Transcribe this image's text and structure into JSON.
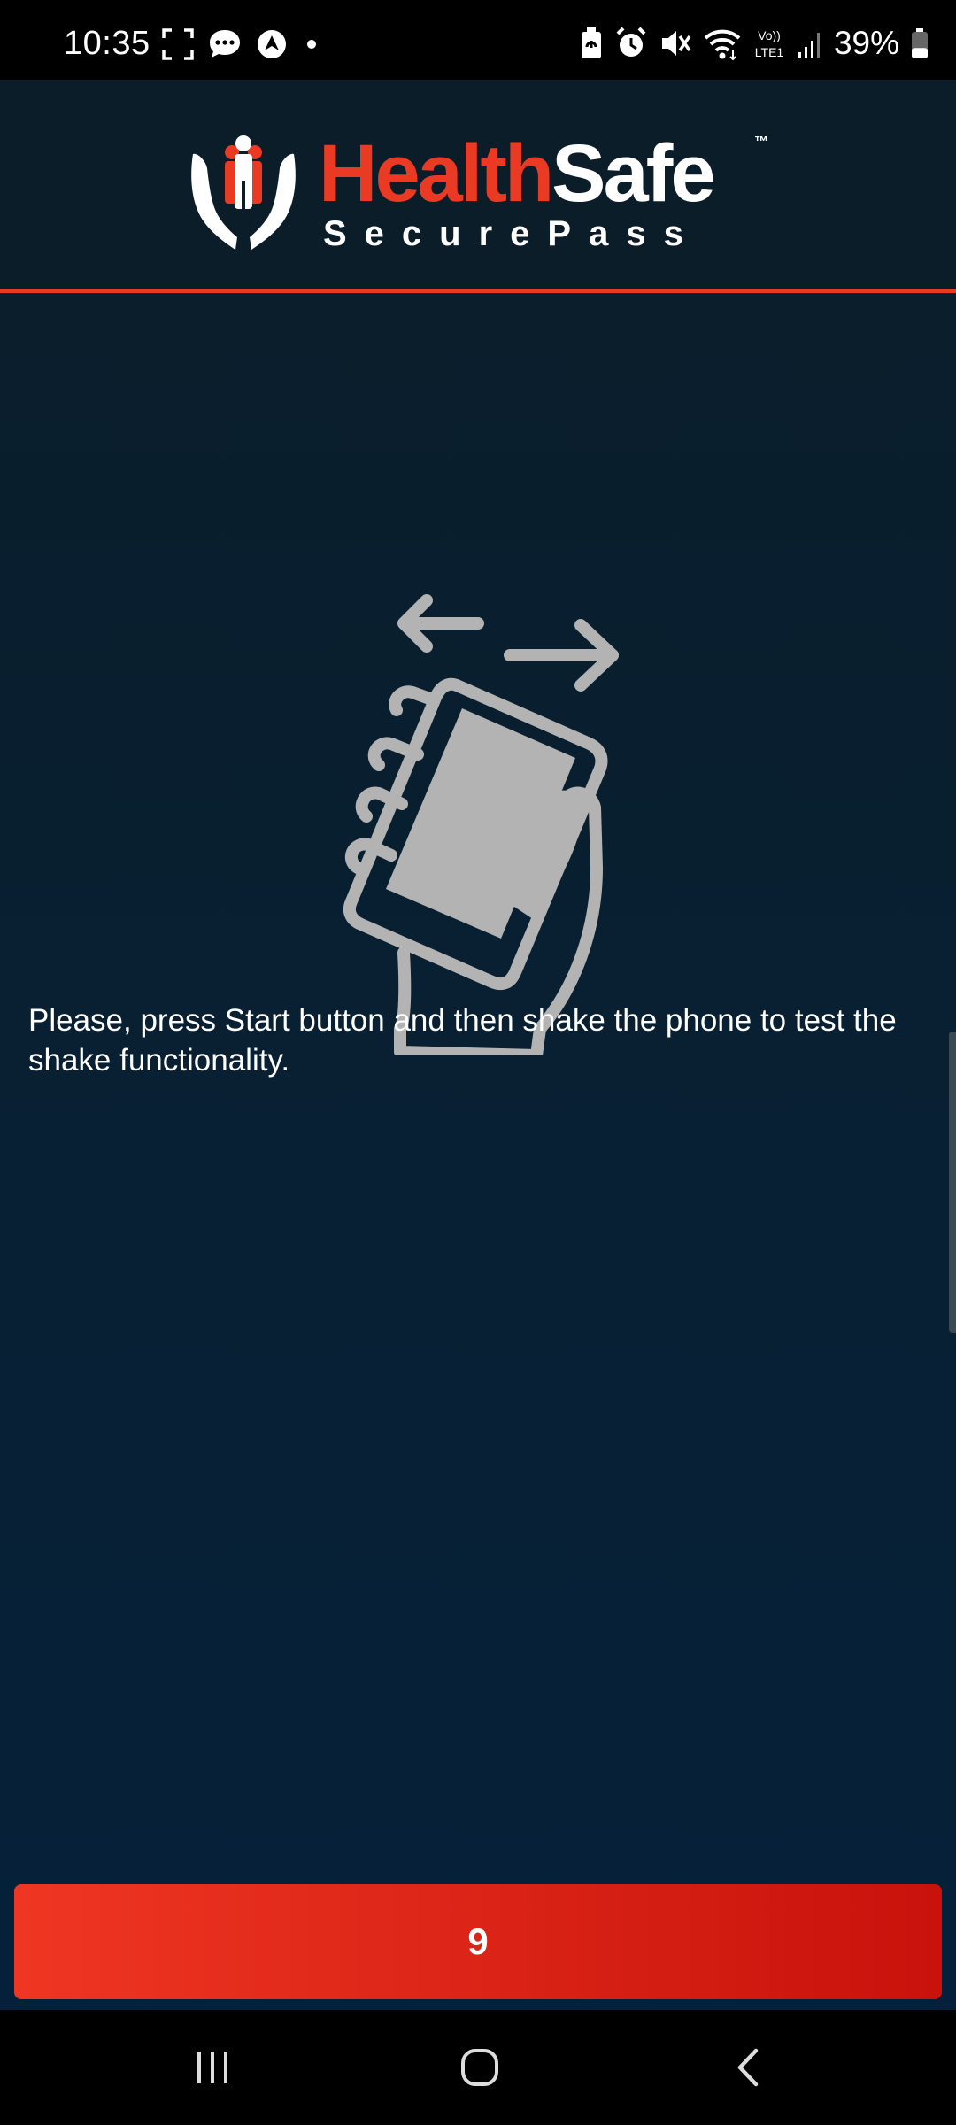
{
  "status_bar": {
    "time": "10:35",
    "left_icons": [
      "screenshot-icon",
      "chat-icon",
      "navigation-icon",
      "dot-icon"
    ],
    "right_icons": [
      "battery-saver-icon",
      "alarm-icon",
      "mute-icon",
      "wifi-icon",
      "volte-icon",
      "signal-icon"
    ],
    "volte_label": "Vo)) LTE1",
    "battery_percent": "39%",
    "battery_level": 0.39
  },
  "header": {
    "logo_health": "Health",
    "logo_safe": "Safe",
    "logo_tm": "™",
    "logo_subtitle": "SecurePass"
  },
  "main": {
    "illustration": "shake-phone-icon",
    "instruction": "Please, press Start button and then shake the phone to test the shake functionality."
  },
  "action_button": {
    "label": "9"
  },
  "nav_bar": {
    "items": [
      "recent-apps-icon",
      "home-icon",
      "back-icon"
    ]
  },
  "colors": {
    "accent_red": "#ea3a24",
    "background": "#0a1d29",
    "illustration_gray": "#b3b3b3"
  }
}
